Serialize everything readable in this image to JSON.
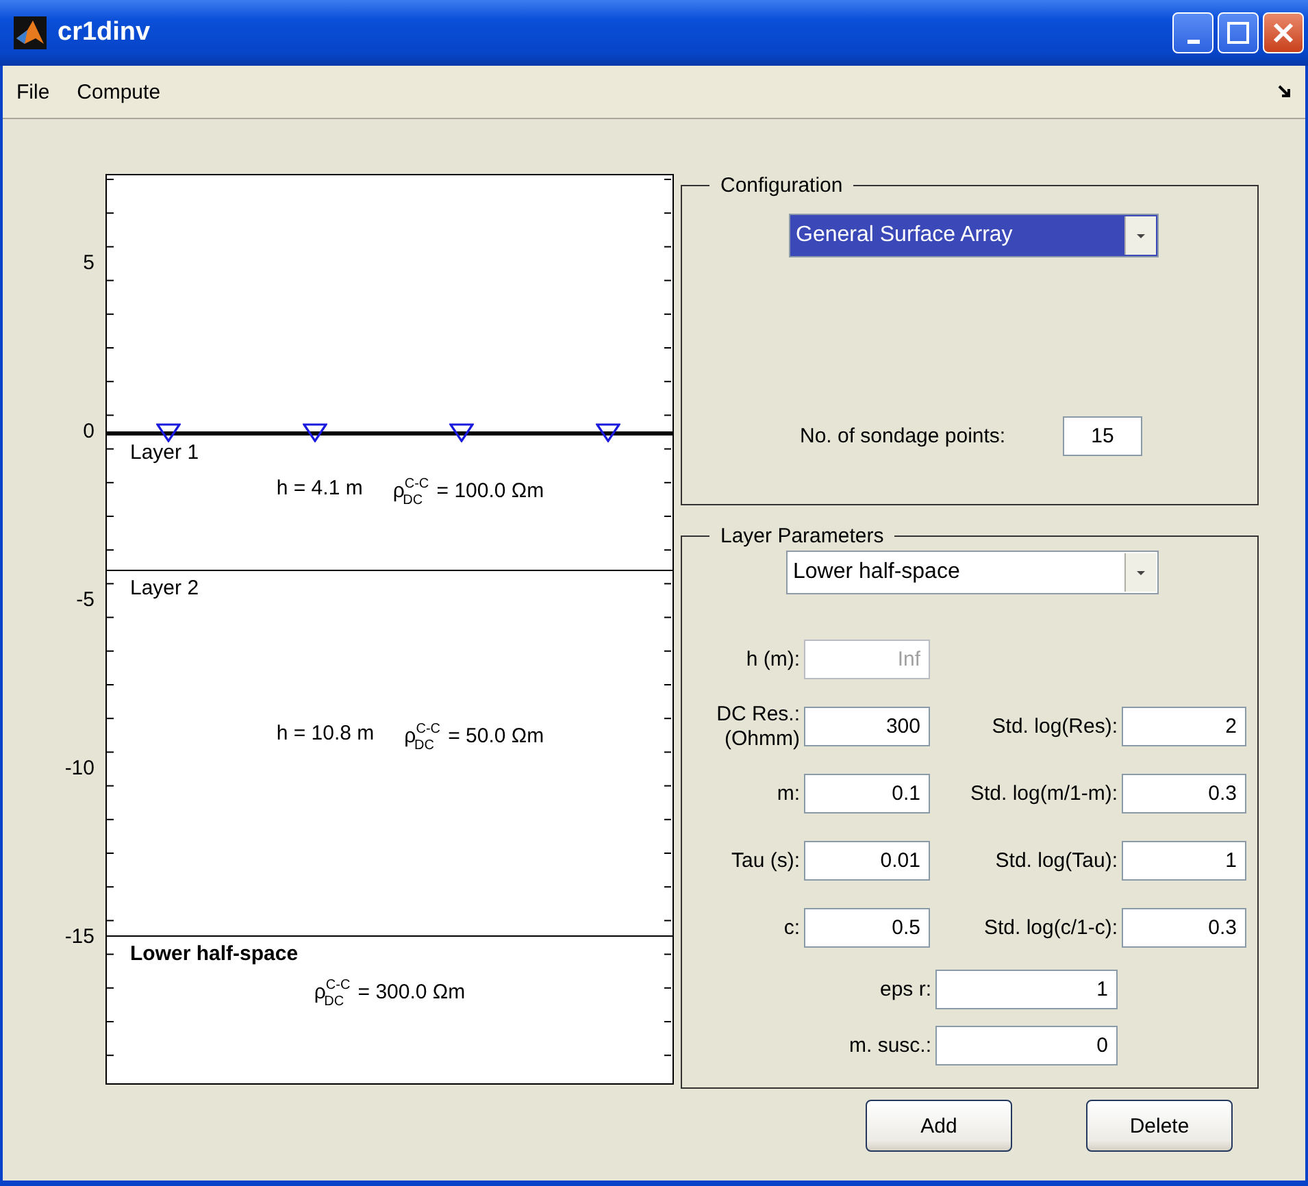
{
  "window": {
    "title": "cr1dinv"
  },
  "menu": [
    "File",
    "Compute"
  ],
  "plot": {
    "yticks": [
      "5",
      "0",
      "-5",
      "-10",
      "-15"
    ],
    "layers": [
      {
        "kind": "layer",
        "name": "Layer 1",
        "thickness": "h = 4.1 m",
        "resistivity": "ρ$^{C-C}$$_{DC}$ = 100.0 Ωm"
      },
      {
        "kind": "layer",
        "name": "Layer 2",
        "thickness": "h = 10.8 m",
        "resistivity": "ρ$^{C-C}$$_{DC}$ = 50.0 Ωm"
      },
      {
        "kind": "halfspace",
        "name": "Lower half-space",
        "resistivity": "ρ$^{C-C}$$_{DC}$ = 300.0 Ωm"
      }
    ]
  },
  "configuration": {
    "title": "Configuration",
    "array_select": {
      "value": "General Surface Array",
      "focused": true
    },
    "sondage_points": {
      "label": "No. of sondage points:",
      "value": "15"
    }
  },
  "layer_parameters": {
    "title": "Layer Parameters",
    "layer_select": {
      "value": "Lower half-space",
      "focused": false
    },
    "rows": [
      {
        "label": "h (m):",
        "value": "Inf",
        "disabled": true
      },
      {
        "label": "DC Res.:\n(Ohmm)",
        "value": "300",
        "disabled": false,
        "std_label": "Std. log(Res):",
        "std_value": "2"
      },
      {
        "label": "m:",
        "value": "0.1",
        "disabled": false,
        "std_label": "Std. log(m/1-m):",
        "std_value": "0.3"
      },
      {
        "label": "Tau (s):",
        "value": "0.01",
        "disabled": false,
        "std_label": "Std. log(Tau):",
        "std_value": "1"
      },
      {
        "label": "c:",
        "value": "0.5",
        "disabled": false,
        "std_label": "Std. log(c/1-c):",
        "std_value": "0.3"
      }
    ],
    "extra_rows": [
      {
        "label": "eps r:",
        "value": "1"
      },
      {
        "label": "m. susc.:",
        "value": "0"
      }
    ]
  },
  "buttons": [
    "Add",
    "Delete"
  ]
}
